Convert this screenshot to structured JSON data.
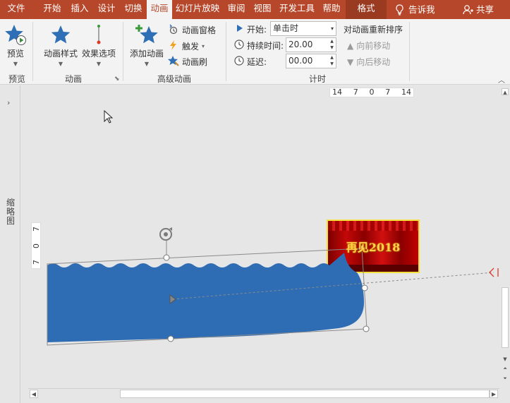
{
  "tabs": [
    {
      "label": "文件",
      "active": false
    },
    {
      "label": "开始",
      "active": false
    },
    {
      "label": "插入",
      "active": false
    },
    {
      "label": "设计",
      "active": false
    },
    {
      "label": "切换",
      "active": false
    },
    {
      "label": "动画",
      "active": true
    },
    {
      "label": "幻灯片放映",
      "active": false
    },
    {
      "label": "审阅",
      "active": false
    },
    {
      "label": "视图",
      "active": false
    },
    {
      "label": "开发工具",
      "active": false
    },
    {
      "label": "帮助",
      "active": false
    },
    {
      "label": "格式",
      "active": false
    }
  ],
  "tell_me": "告诉我",
  "share": "共享",
  "ribbon": {
    "preview": {
      "button": "预览",
      "group": "预览"
    },
    "animation": {
      "styles": "动画样式",
      "effects": "效果选项",
      "group": "动画"
    },
    "advanced": {
      "add": "添加动画",
      "pane": "动画窗格",
      "trigger": "触发",
      "painter": "动画刷",
      "group": "高级动画"
    },
    "timing": {
      "start_label": "开始:",
      "start_value": "单击时",
      "duration_label": "持续时间:",
      "duration_value": "20.00",
      "delay_label": "延迟:",
      "delay_value": "00.00",
      "reorder_title": "对动画重新排序",
      "move_earlier": "向前移动",
      "move_later": "向后移动",
      "group": "计时"
    }
  },
  "thumbnails_label": "缩略图",
  "ruler_h": [
    "14",
    "7",
    "0",
    "7",
    "14"
  ],
  "ruler_v": [
    "7",
    "0",
    "7"
  ],
  "banner_text": "再见2018",
  "colors": {
    "tabbar": "#b7472a",
    "wave_fill": "#2e6db4",
    "banner_border": "#f3e03a"
  }
}
